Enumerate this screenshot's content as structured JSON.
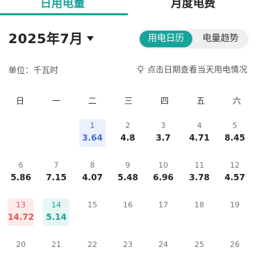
{
  "tabs": {
    "active": "日用电量",
    "inactive": "月度电费"
  },
  "header": {
    "month": "2025年7月"
  },
  "view_toggle": {
    "calendar": "用电日历",
    "trend": "电量趋势"
  },
  "unit_label": "单位：千瓦时",
  "hint": "点击日期查看当天用电情况",
  "weekdays": [
    "日",
    "一",
    "二",
    "三",
    "四",
    "五",
    "六"
  ],
  "colors": {
    "accent": "#1aa39a",
    "highlight_low": "#4a6fd1",
    "highlight_high": "#e0575a"
  },
  "days": [
    {
      "day": "1",
      "value": "3.64",
      "highlight": "blue"
    },
    {
      "day": "2",
      "value": "4.8"
    },
    {
      "day": "3",
      "value": "3.7"
    },
    {
      "day": "4",
      "value": "4.71"
    },
    {
      "day": "5",
      "value": "8.45"
    },
    {
      "day": "6",
      "value": "5.86"
    },
    {
      "day": "7",
      "value": "7.15"
    },
    {
      "day": "8",
      "value": "4.07"
    },
    {
      "day": "9",
      "value": "5.48"
    },
    {
      "day": "10",
      "value": "6.96"
    },
    {
      "day": "11",
      "value": "3.78"
    },
    {
      "day": "12",
      "value": "4.57"
    },
    {
      "day": "13",
      "value": "14.72",
      "highlight": "red"
    },
    {
      "day": "14",
      "value": "5.14",
      "highlight": "teal"
    },
    {
      "day": "15",
      "value": ""
    },
    {
      "day": "16",
      "value": ""
    },
    {
      "day": "17",
      "value": ""
    },
    {
      "day": "18",
      "value": ""
    },
    {
      "day": "19",
      "value": ""
    },
    {
      "day": "20",
      "value": ""
    },
    {
      "day": "21",
      "value": ""
    },
    {
      "day": "22",
      "value": ""
    },
    {
      "day": "23",
      "value": ""
    },
    {
      "day": "24",
      "value": ""
    },
    {
      "day": "25",
      "value": ""
    },
    {
      "day": "26",
      "value": ""
    }
  ]
}
